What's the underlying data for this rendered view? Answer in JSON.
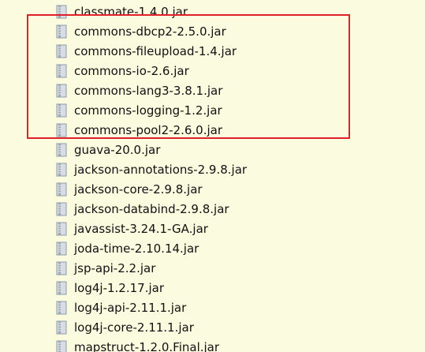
{
  "files": [
    {
      "name": "classmate-1.4.0.jar",
      "icon": "jar-file-icon"
    },
    {
      "name": "commons-dbcp2-2.5.0.jar",
      "icon": "jar-file-icon"
    },
    {
      "name": "commons-fileupload-1.4.jar",
      "icon": "jar-file-icon"
    },
    {
      "name": "commons-io-2.6.jar",
      "icon": "jar-file-icon"
    },
    {
      "name": "commons-lang3-3.8.1.jar",
      "icon": "jar-file-icon"
    },
    {
      "name": "commons-logging-1.2.jar",
      "icon": "jar-file-icon"
    },
    {
      "name": "commons-pool2-2.6.0.jar",
      "icon": "jar-file-icon"
    },
    {
      "name": "guava-20.0.jar",
      "icon": "jar-file-icon"
    },
    {
      "name": "jackson-annotations-2.9.8.jar",
      "icon": "jar-file-icon"
    },
    {
      "name": "jackson-core-2.9.8.jar",
      "icon": "jar-file-icon"
    },
    {
      "name": "jackson-databind-2.9.8.jar",
      "icon": "jar-file-icon"
    },
    {
      "name": "javassist-3.24.1-GA.jar",
      "icon": "jar-file-icon"
    },
    {
      "name": "joda-time-2.10.14.jar",
      "icon": "jar-file-icon"
    },
    {
      "name": "jsp-api-2.2.jar",
      "icon": "jar-file-icon"
    },
    {
      "name": "log4j-1.2.17.jar",
      "icon": "jar-file-icon"
    },
    {
      "name": "log4j-api-2.11.1.jar",
      "icon": "jar-file-icon"
    },
    {
      "name": "log4j-core-2.11.1.jar",
      "icon": "jar-file-icon"
    },
    {
      "name": "mapstruct-1.2.0.Final.jar",
      "icon": "jar-file-icon"
    }
  ],
  "highlight": {
    "color": "#e0212a",
    "first_file": "commons-dbcp2-2.5.0.jar",
    "last_file": "commons-pool2-2.6.0.jar"
  },
  "colors": {
    "background": "#fbfbe0",
    "icon_body": "#d8dde3",
    "icon_stripe": "#8f9aa8"
  }
}
